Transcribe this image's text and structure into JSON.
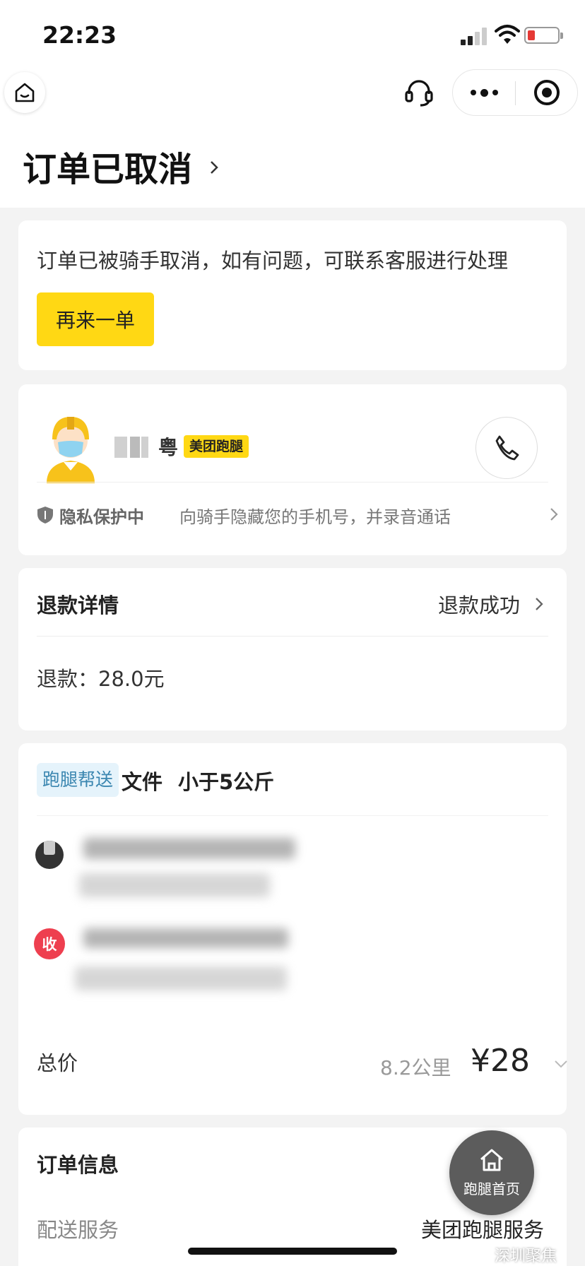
{
  "status_bar": {
    "time": "22:23"
  },
  "header": {
    "title": "订单已取消"
  },
  "cancel_card": {
    "message": "订单已被骑手取消，如有问题，可联系客服进行处理",
    "reorder_label": "再来一单"
  },
  "rider_card": {
    "name_visible": "粤",
    "brand_badge": "美团跑腿",
    "privacy_title": "隐私保护中",
    "privacy_desc": "向骑手隐藏您的手机号，并录音通话"
  },
  "refund_card": {
    "title": "退款详情",
    "status": "退款成功",
    "amount_text": "退款：28.0元"
  },
  "delivery_card": {
    "service_tag": "跑腿帮送",
    "item": "文件",
    "weight": "小于5公斤",
    "receiver_icon": "收",
    "total_label": "总价",
    "distance": "8.2公里",
    "price": "¥28"
  },
  "order_info": {
    "title": "订单信息",
    "delivery_label": "配送服务",
    "delivery_value": "美团跑腿服务"
  },
  "fab": {
    "label": "跑腿首页"
  },
  "watermark": "深圳聚焦",
  "colors": {
    "accent_yellow": "#ffd814",
    "receiver_red": "#ee3f4f",
    "tag_blue": "#3a86b0"
  }
}
